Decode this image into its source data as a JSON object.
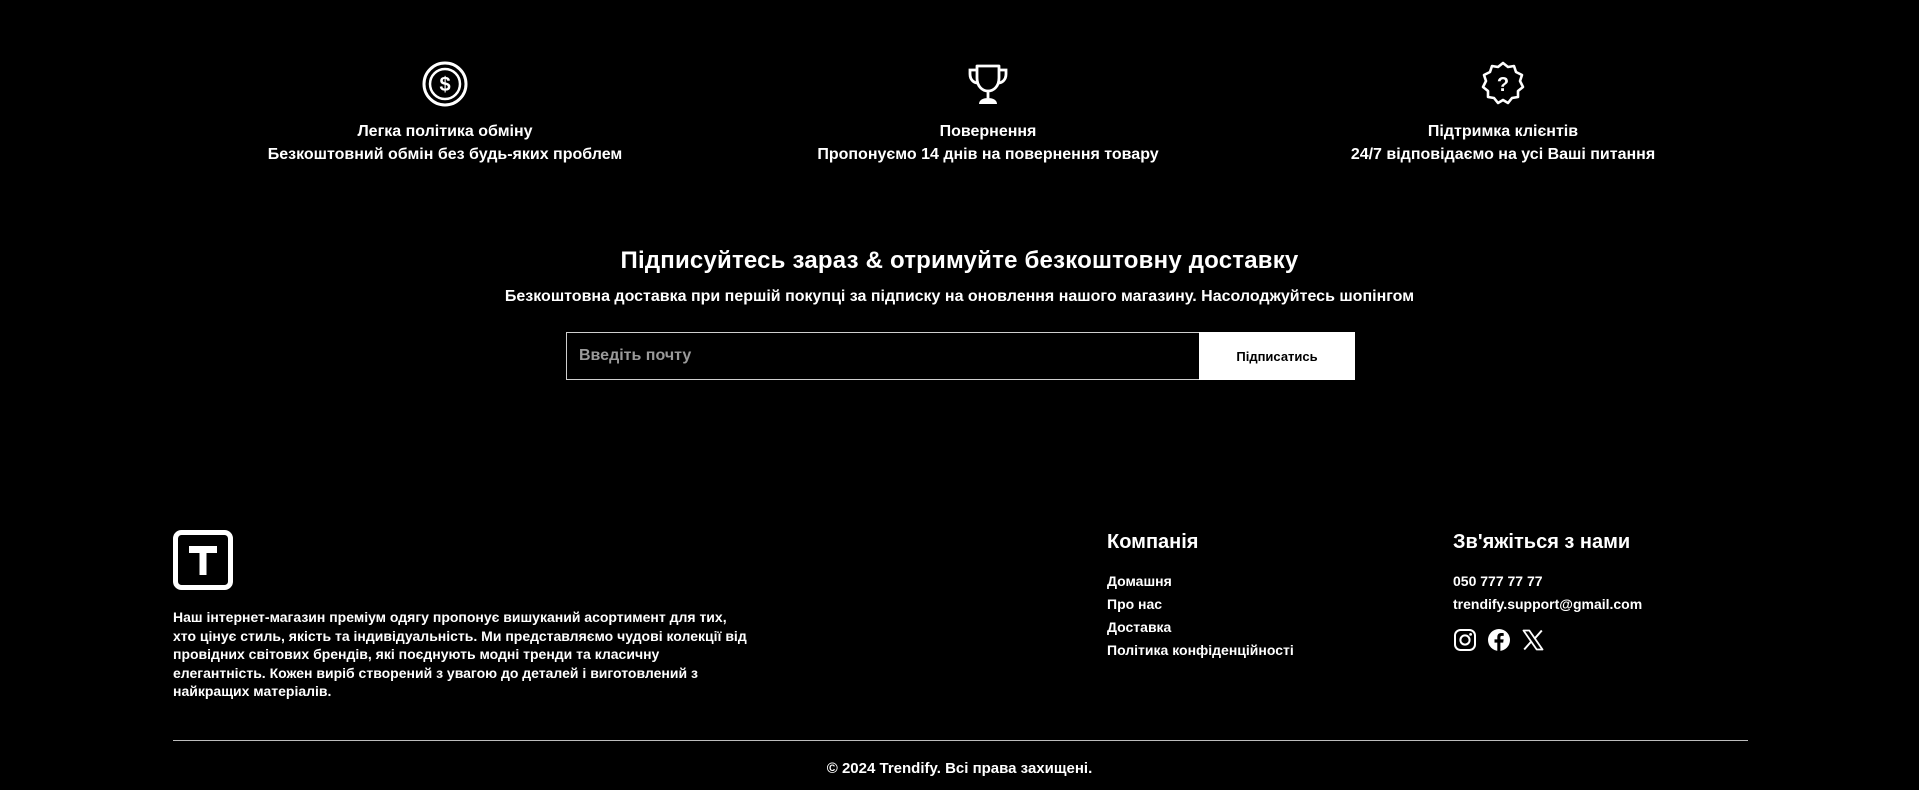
{
  "features": [
    {
      "icon": "dollar-coin-icon",
      "title": "Легка політика обміну",
      "text": "Безкоштовний обмін без будь-яких проблем"
    },
    {
      "icon": "trophy-icon",
      "title": "Повернення",
      "text": "Пропонуємо 14 днів на повернення товару"
    },
    {
      "icon": "question-badge-icon",
      "title": "Підтримка клієнтів",
      "text": "24/7 відповідаємо на усі Ваші питання"
    }
  ],
  "subscribe": {
    "title": "Підписуйтесь зараз & отримуйте безкоштовну доставку",
    "subtitle": "Безкоштовна доставка при першій покупці за підписку на оновлення нашого магазину. Насолоджуйтесь шопінгом",
    "input_placeholder": "Введіть почту",
    "input_value": "",
    "button_label": "Підписатись"
  },
  "footer": {
    "logo_letter": "T",
    "description": "Наш інтернет-магазин преміум одягу пропонує вишуканий асортимент для тих, хто цінує стиль, якість та індивідуальність. Ми представляємо чудові колекції від провідних світових брендів, які поєднують модні тренди та класичну елегантність. Кожен виріб створений з увагою до деталей і виготовлений з найкращих матеріалів.",
    "company": {
      "title": "Компанія",
      "links": [
        "Домашня",
        "Про нас",
        "Доставка",
        "Політика конфіденційності"
      ]
    },
    "contact": {
      "title": "Зв'яжіться з нами",
      "phone": "050 777 77 77",
      "email": "trendify.support@gmail.com",
      "socials": [
        "instagram-icon",
        "facebook-icon",
        "x-twitter-icon"
      ]
    },
    "copyright": "© 2024 Trendify. Всі права захищені."
  },
  "colors": {
    "background": "#000000",
    "text": "#ffffff",
    "button_bg": "#ffffff",
    "button_text": "#000000",
    "placeholder": "#9a9a9a"
  }
}
